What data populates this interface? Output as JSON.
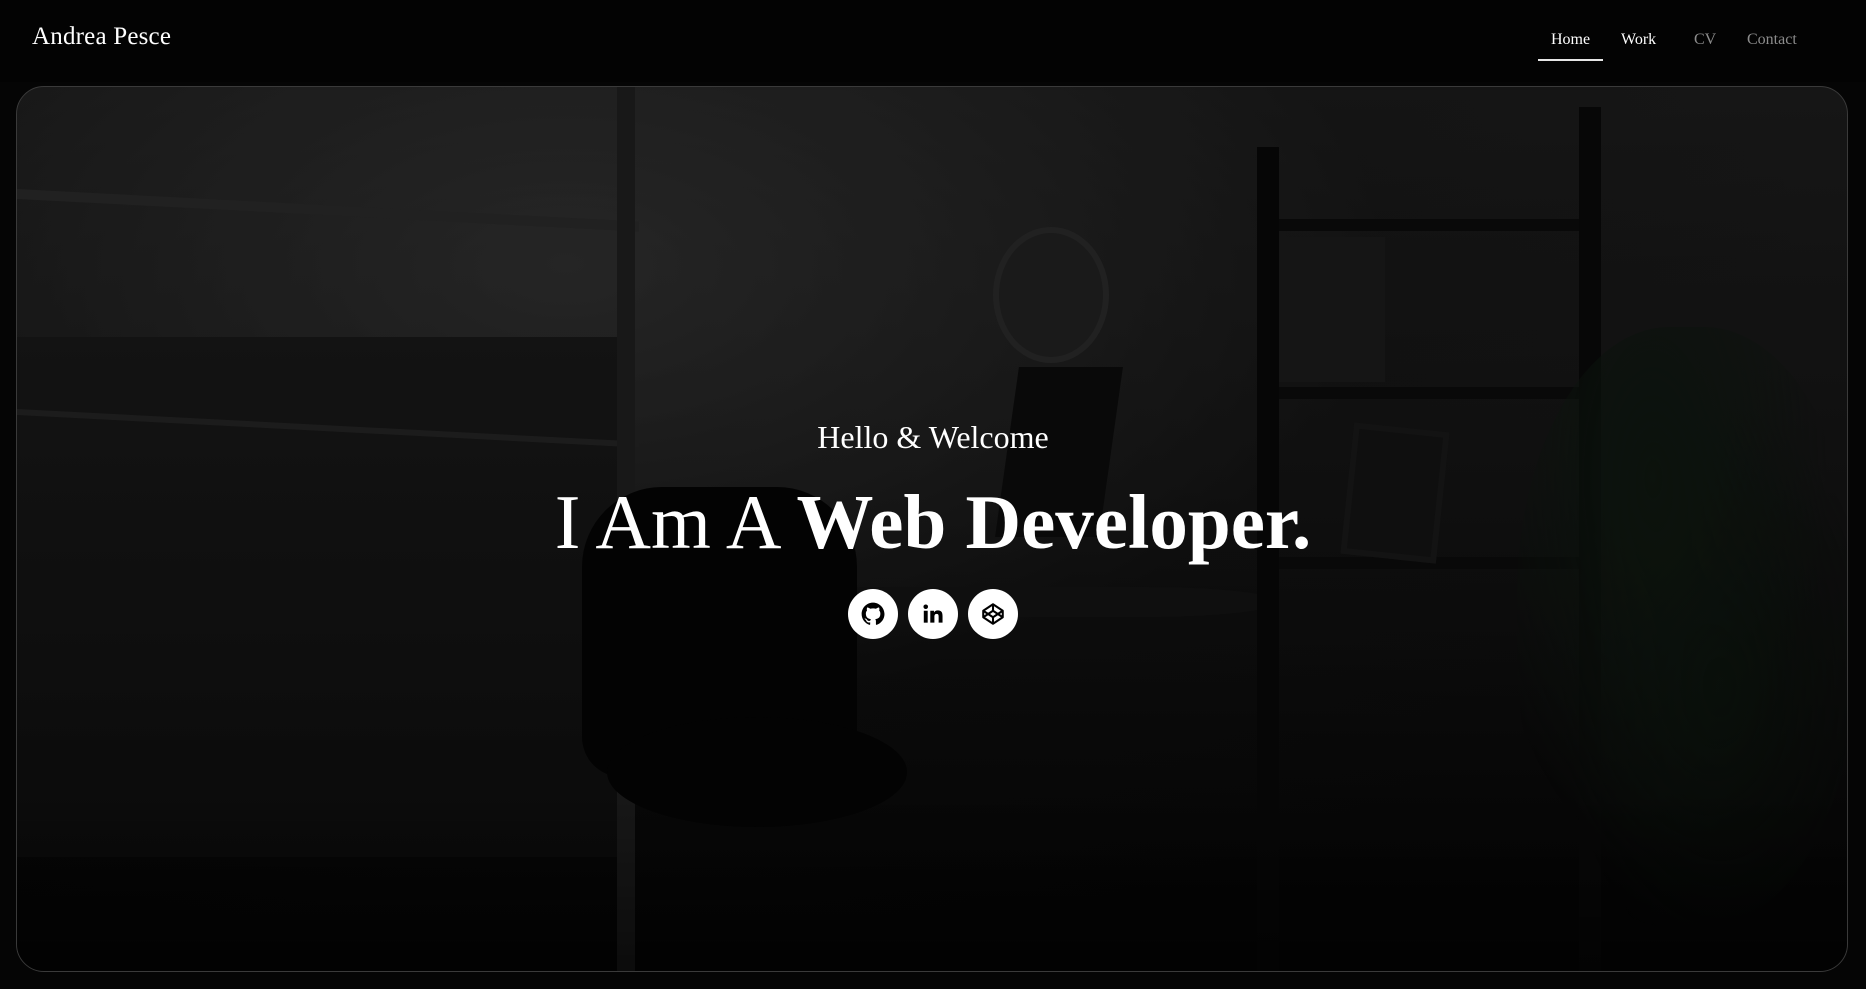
{
  "header": {
    "brand": "Andrea Pesce",
    "nav": [
      {
        "label": "Home",
        "active": true
      },
      {
        "label": "Work",
        "active": false
      },
      {
        "label": "CV",
        "active": false
      },
      {
        "label": "Contact",
        "active": false
      }
    ]
  },
  "hero": {
    "greeting": "Hello & Welcome",
    "headline_part1": "I Am A",
    "headline_part2": "Web Developer.",
    "social_links": [
      {
        "icon": "github-icon"
      },
      {
        "icon": "linkedin-icon"
      },
      {
        "icon": "codepen-icon"
      }
    ]
  },
  "colors": {
    "background": "#050505",
    "text": "#ffffff",
    "nav_muted": "#8c8c8c",
    "hero_border": "#3a3a3a"
  }
}
